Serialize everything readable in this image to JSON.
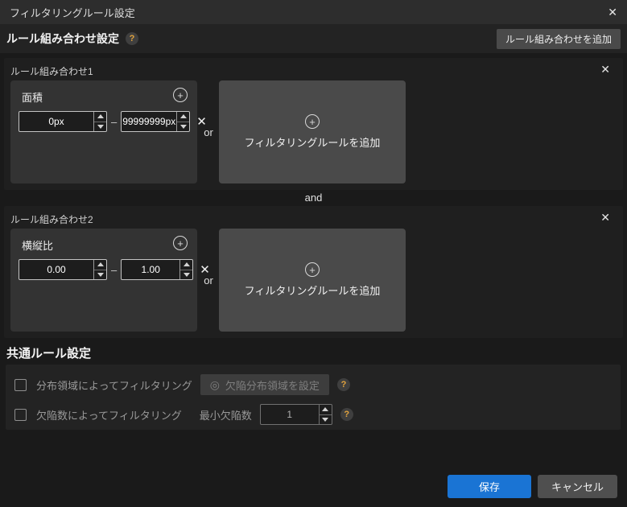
{
  "titlebar": {
    "title": "フィルタリングルール設定",
    "close_glyph": "✕"
  },
  "header": {
    "title": "ルール組み合わせ設定",
    "help_glyph": "?",
    "add_button_label": "ルール組み合わせを追加"
  },
  "and_label": "and",
  "groups": [
    {
      "title": "ルール組み合わせ1",
      "close_glyph": "✕",
      "rule": {
        "name": "面積",
        "min": "0px",
        "max": "99999999px",
        "range_dash": "–",
        "remove_glyph": "✕",
        "add_glyph": "+"
      },
      "or_label": "or",
      "add_panel": {
        "glyph": "+",
        "label": "フィルタリングルールを追加"
      }
    },
    {
      "title": "ルール組み合わせ2",
      "close_glyph": "✕",
      "rule": {
        "name": "横縦比",
        "min": "0.00",
        "max": "1.00",
        "range_dash": "–",
        "remove_glyph": "✕",
        "add_glyph": "+"
      },
      "or_label": "or",
      "add_panel": {
        "glyph": "+",
        "label": "フィルタリングルールを追加"
      }
    }
  ],
  "common": {
    "title": "共通ルール設定",
    "distribution_row": {
      "checked": false,
      "label": "分布領域によってフィルタリング",
      "button_icon_glyph": "◎",
      "button_label": "欠陥分布領域を設定",
      "help_glyph": "?"
    },
    "count_row": {
      "checked": false,
      "label": "欠陥数によってフィルタリング",
      "min_count_label": "最小欠陥数",
      "min_count_value": "1",
      "help_glyph": "?"
    }
  },
  "footer": {
    "save_label": "保存",
    "cancel_label": "キャンセル"
  },
  "colors": {
    "accent_blue": "#1a74d4",
    "help_orange": "#e2a33e"
  }
}
